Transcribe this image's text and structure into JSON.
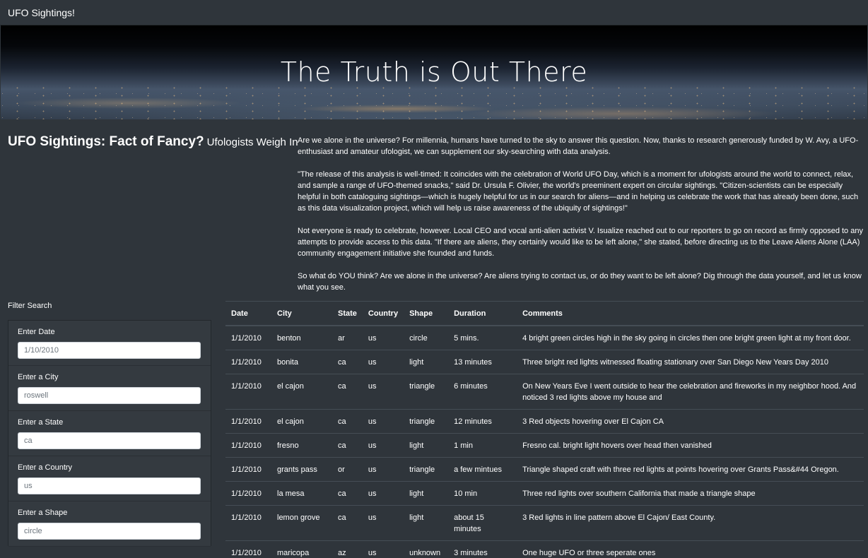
{
  "navbar": {
    "brand": "UFO Sightings!"
  },
  "hero": {
    "title": "The Truth is Out There"
  },
  "intro": {
    "title": "UFO Sightings: Fact of Fancy?",
    "subtitle": "Ufologists Weigh In"
  },
  "article": {
    "paragraphs": [
      "Are we alone in the universe? For millennia, humans have turned to the sky to answer this question. Now, thanks to research generously funded by W. Avy, a UFO-enthusiast and amateur ufologist, we can supplement our sky-searching with data analysis.",
      "\"The release of this analysis is well-timed: It coincides with the celebration of World UFO Day, which is a moment for ufologists around the world to connect, relax, and sample a range of UFO-themed snacks,\" said Dr. Ursula F. Olivier, the world's preeminent expert on circular sightings. \"Citizen-scientists can be especially helpful in both cataloguing sightings—which is hugely helpful for us in our search for aliens—and in helping us celebrate the work that has already been done, such as this data visualization project, which will help us raise awareness of the ubiquity of sightings!\"",
      "Not everyone is ready to celebrate, however. Local CEO and vocal anti-alien activist V. Isualize reached out to our reporters to go on record as firmly opposed to any attempts to provide access to this data. \"If there are aliens, they certainly would like to be left alone,\" she stated, before directing us to the Leave Aliens Alone (LAA) community engagement initiative she founded and funds.",
      "So what do YOU think? Are we alone in the universe? Are aliens trying to contact us, or do they want to be left alone? Dig through the data yourself, and let us know what you see."
    ]
  },
  "filters": {
    "heading": "Filter Search",
    "items": [
      {
        "label": "Enter Date",
        "placeholder": "1/10/2010"
      },
      {
        "label": "Enter a City",
        "placeholder": "roswell"
      },
      {
        "label": "Enter a State",
        "placeholder": "ca"
      },
      {
        "label": "Enter a Country",
        "placeholder": "us"
      },
      {
        "label": "Enter a Shape",
        "placeholder": "circle"
      }
    ]
  },
  "table": {
    "headers": [
      "Date",
      "City",
      "State",
      "Country",
      "Shape",
      "Duration",
      "Comments"
    ],
    "rows": [
      [
        "1/1/2010",
        "benton",
        "ar",
        "us",
        "circle",
        "5 mins.",
        "4 bright green circles high in the sky going in circles then one bright green light at my front door."
      ],
      [
        "1/1/2010",
        "bonita",
        "ca",
        "us",
        "light",
        "13 minutes",
        "Three bright red lights witnessed floating stationary over San Diego New Years Day 2010"
      ],
      [
        "1/1/2010",
        "el cajon",
        "ca",
        "us",
        "triangle",
        "6 minutes",
        "On New Years Eve I went outside to hear the celebration and fireworks in my neighbor hood. And noticed 3 red lights above my house and"
      ],
      [
        "1/1/2010",
        "el cajon",
        "ca",
        "us",
        "triangle",
        "12 minutes",
        "3 Red objects hovering over El Cajon CA"
      ],
      [
        "1/1/2010",
        "fresno",
        "ca",
        "us",
        "light",
        "1 min",
        "Fresno cal. bright light hovers over head then vanished"
      ],
      [
        "1/1/2010",
        "grants pass",
        "or",
        "us",
        "triangle",
        "a few mintues",
        "Triangle shaped craft with three red lights at points hovering over Grants Pass&#44 Oregon."
      ],
      [
        "1/1/2010",
        "la mesa",
        "ca",
        "us",
        "light",
        "10 min",
        "Three red lights over southern California that made a triangle shape"
      ],
      [
        "1/1/2010",
        "lemon grove",
        "ca",
        "us",
        "light",
        "about 15 minutes",
        "3 Red lights in line pattern above El Cajon/ East County."
      ],
      [
        "1/1/2010",
        "maricopa",
        "az",
        "us",
        "unknown",
        "3 minutes",
        "One huge UFO or three seperate ones"
      ]
    ]
  }
}
